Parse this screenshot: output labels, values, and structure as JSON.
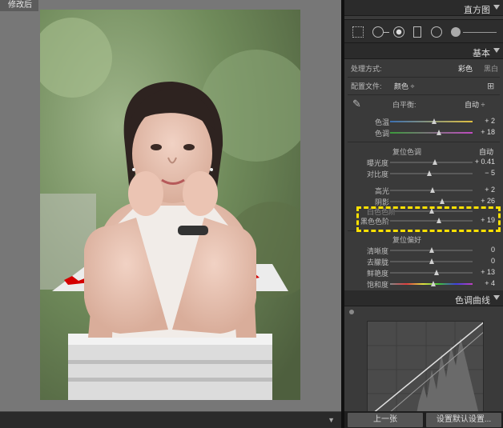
{
  "preview": {
    "view_label": "修改后"
  },
  "panel": {
    "histogram_title": "直方图",
    "basic_title": "基本",
    "treatment": {
      "label": "处理方式:",
      "color": "彩色",
      "bw": "黑白"
    },
    "profile": {
      "label": "配置文件:",
      "value": "颜色 ÷"
    },
    "wb": {
      "label": "白平衡:",
      "value": "自动 ÷"
    },
    "temp": {
      "label": "色温",
      "value": "+ 2",
      "pos": 0.53,
      "track": "linear-gradient(90deg,#3c6fb0,#e0c040)"
    },
    "tint": {
      "label": "色调",
      "value": "+ 18",
      "pos": 0.59,
      "track": "linear-gradient(90deg,#3b9a3b,#c04ac0)"
    },
    "tone_reset": "复位色调",
    "tone_auto": "自动",
    "exposure": {
      "label": "曝光度",
      "value": "+ 0.41",
      "pos": 0.54
    },
    "contrast": {
      "label": "对比度",
      "value": "− 5",
      "pos": 0.48
    },
    "highlights": {
      "label": "高光",
      "value": "+ 2",
      "pos": 0.51
    },
    "shadows": {
      "label": "阴影",
      "value": "+ 26",
      "pos": 0.63
    },
    "whites": {
      "label": "白色色阶",
      "value": "",
      "pos": 0.5
    },
    "blacks": {
      "label": "黑色色阶",
      "value": "+ 19",
      "pos": 0.59
    },
    "presence_reset": "复位偏好",
    "clarity": {
      "label": "清晰度",
      "value": "0",
      "pos": 0.5
    },
    "dehaze": {
      "label": "去朦胧",
      "value": "0",
      "pos": 0.5
    },
    "vibrance": {
      "label": "鲜艳度",
      "value": "+ 13",
      "pos": 0.56
    },
    "saturation": {
      "label": "饱和度",
      "value": "+ 4",
      "pos": 0.52,
      "track": "linear-gradient(90deg,#888,#e04040,#e0e040,#40c040,#4040e0,#c040c0)"
    },
    "curve_title": "色调曲线",
    "buttons": {
      "prev": "上一张",
      "reset": "设置默认设置..."
    }
  },
  "colors": {
    "highlight": "#ffe100",
    "panel_bg": "#3a3a3a",
    "header_bg": "#2b2b2b"
  }
}
